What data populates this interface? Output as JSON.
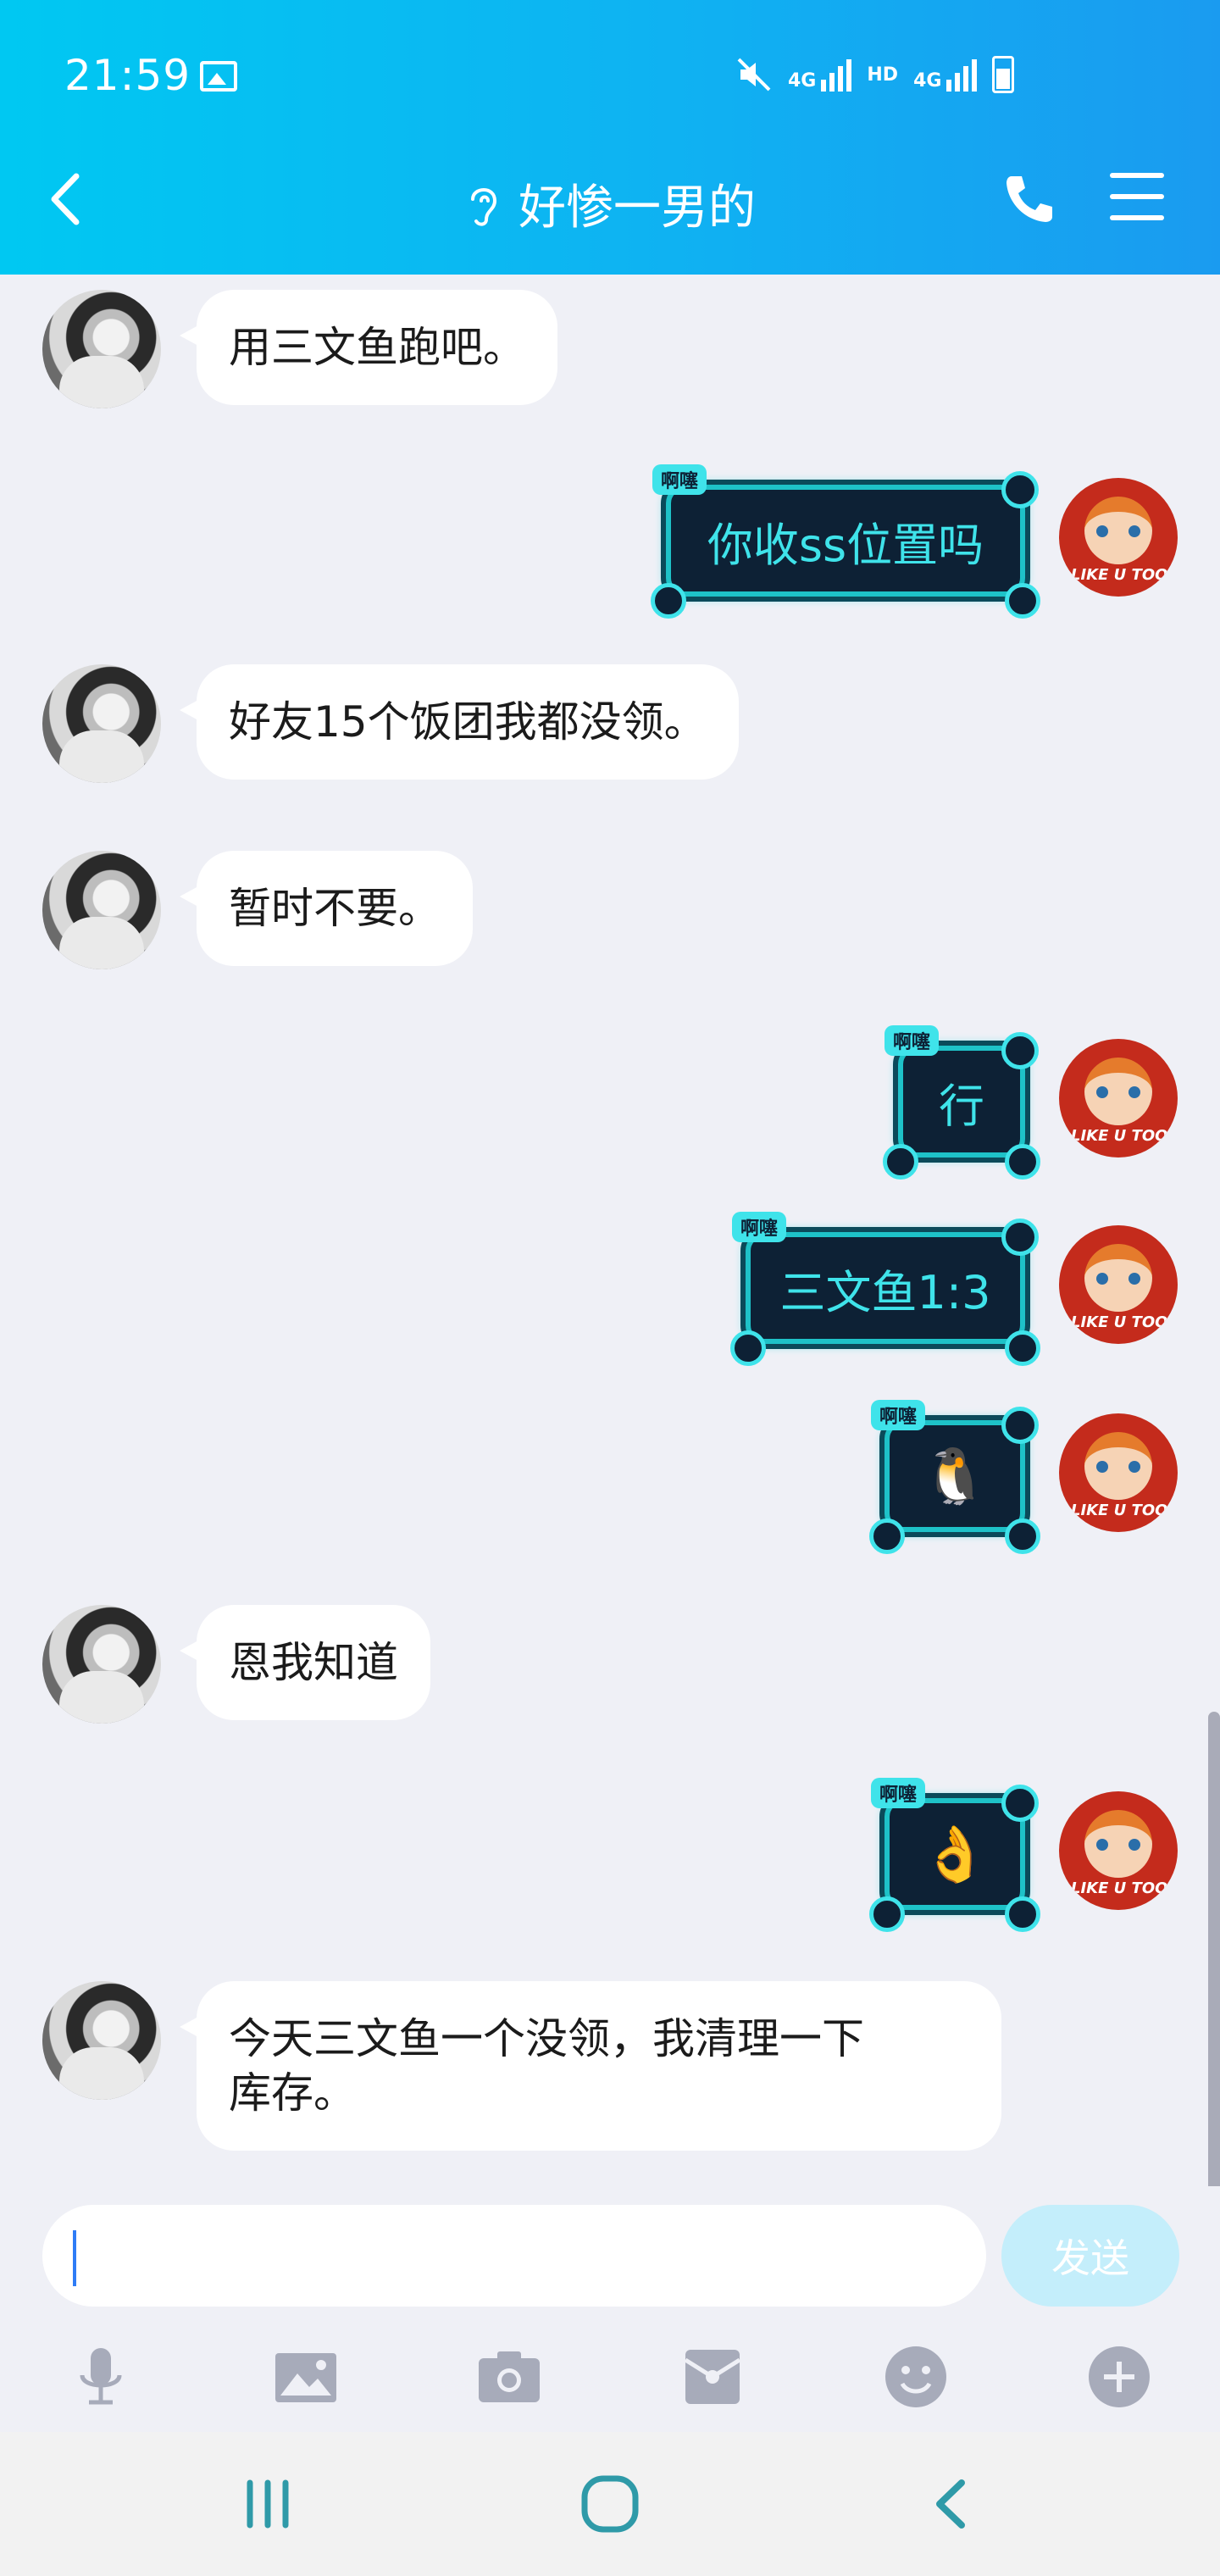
{
  "status_bar": {
    "time": "21:59",
    "network_1": "4G",
    "hd": "HD",
    "network_2": "4G"
  },
  "header": {
    "title": "好惨一男的"
  },
  "messages": [
    {
      "side": "left",
      "text": "用三文鱼跑吧。"
    },
    {
      "side": "right",
      "text": "你收ss位置吗",
      "tag": "啊噻"
    },
    {
      "side": "left",
      "text": "好友15个饭团我都没领。"
    },
    {
      "side": "left",
      "text": "暂时不要。"
    },
    {
      "side": "right",
      "text": "行",
      "tag": "啊噻"
    },
    {
      "side": "right",
      "text": "三文鱼1:3",
      "tag": "啊噻"
    },
    {
      "side": "right",
      "text": "🐧",
      "tag": "啊噻"
    },
    {
      "side": "left",
      "text": "恩我知道"
    },
    {
      "side": "right",
      "text": "👌",
      "tag": "啊噻"
    },
    {
      "side": "left",
      "text": "今天三文鱼一个没领，我清理一下",
      "text2": "库存。"
    }
  ],
  "avatar_right_tag": "LIKE U TOO",
  "input": {
    "value": "",
    "send_label": "发送"
  },
  "toolbar_icons": [
    "microphone-icon",
    "image-icon",
    "camera-icon",
    "red-packet-icon",
    "emoji-icon",
    "plus-icon"
  ],
  "colors": {
    "header_start": "#00c8f2",
    "header_end": "#1a9bf0",
    "bubble_border": "#1ec2c8",
    "bubble_text": "#3fe3ea",
    "send_button": "#c4eefb"
  }
}
